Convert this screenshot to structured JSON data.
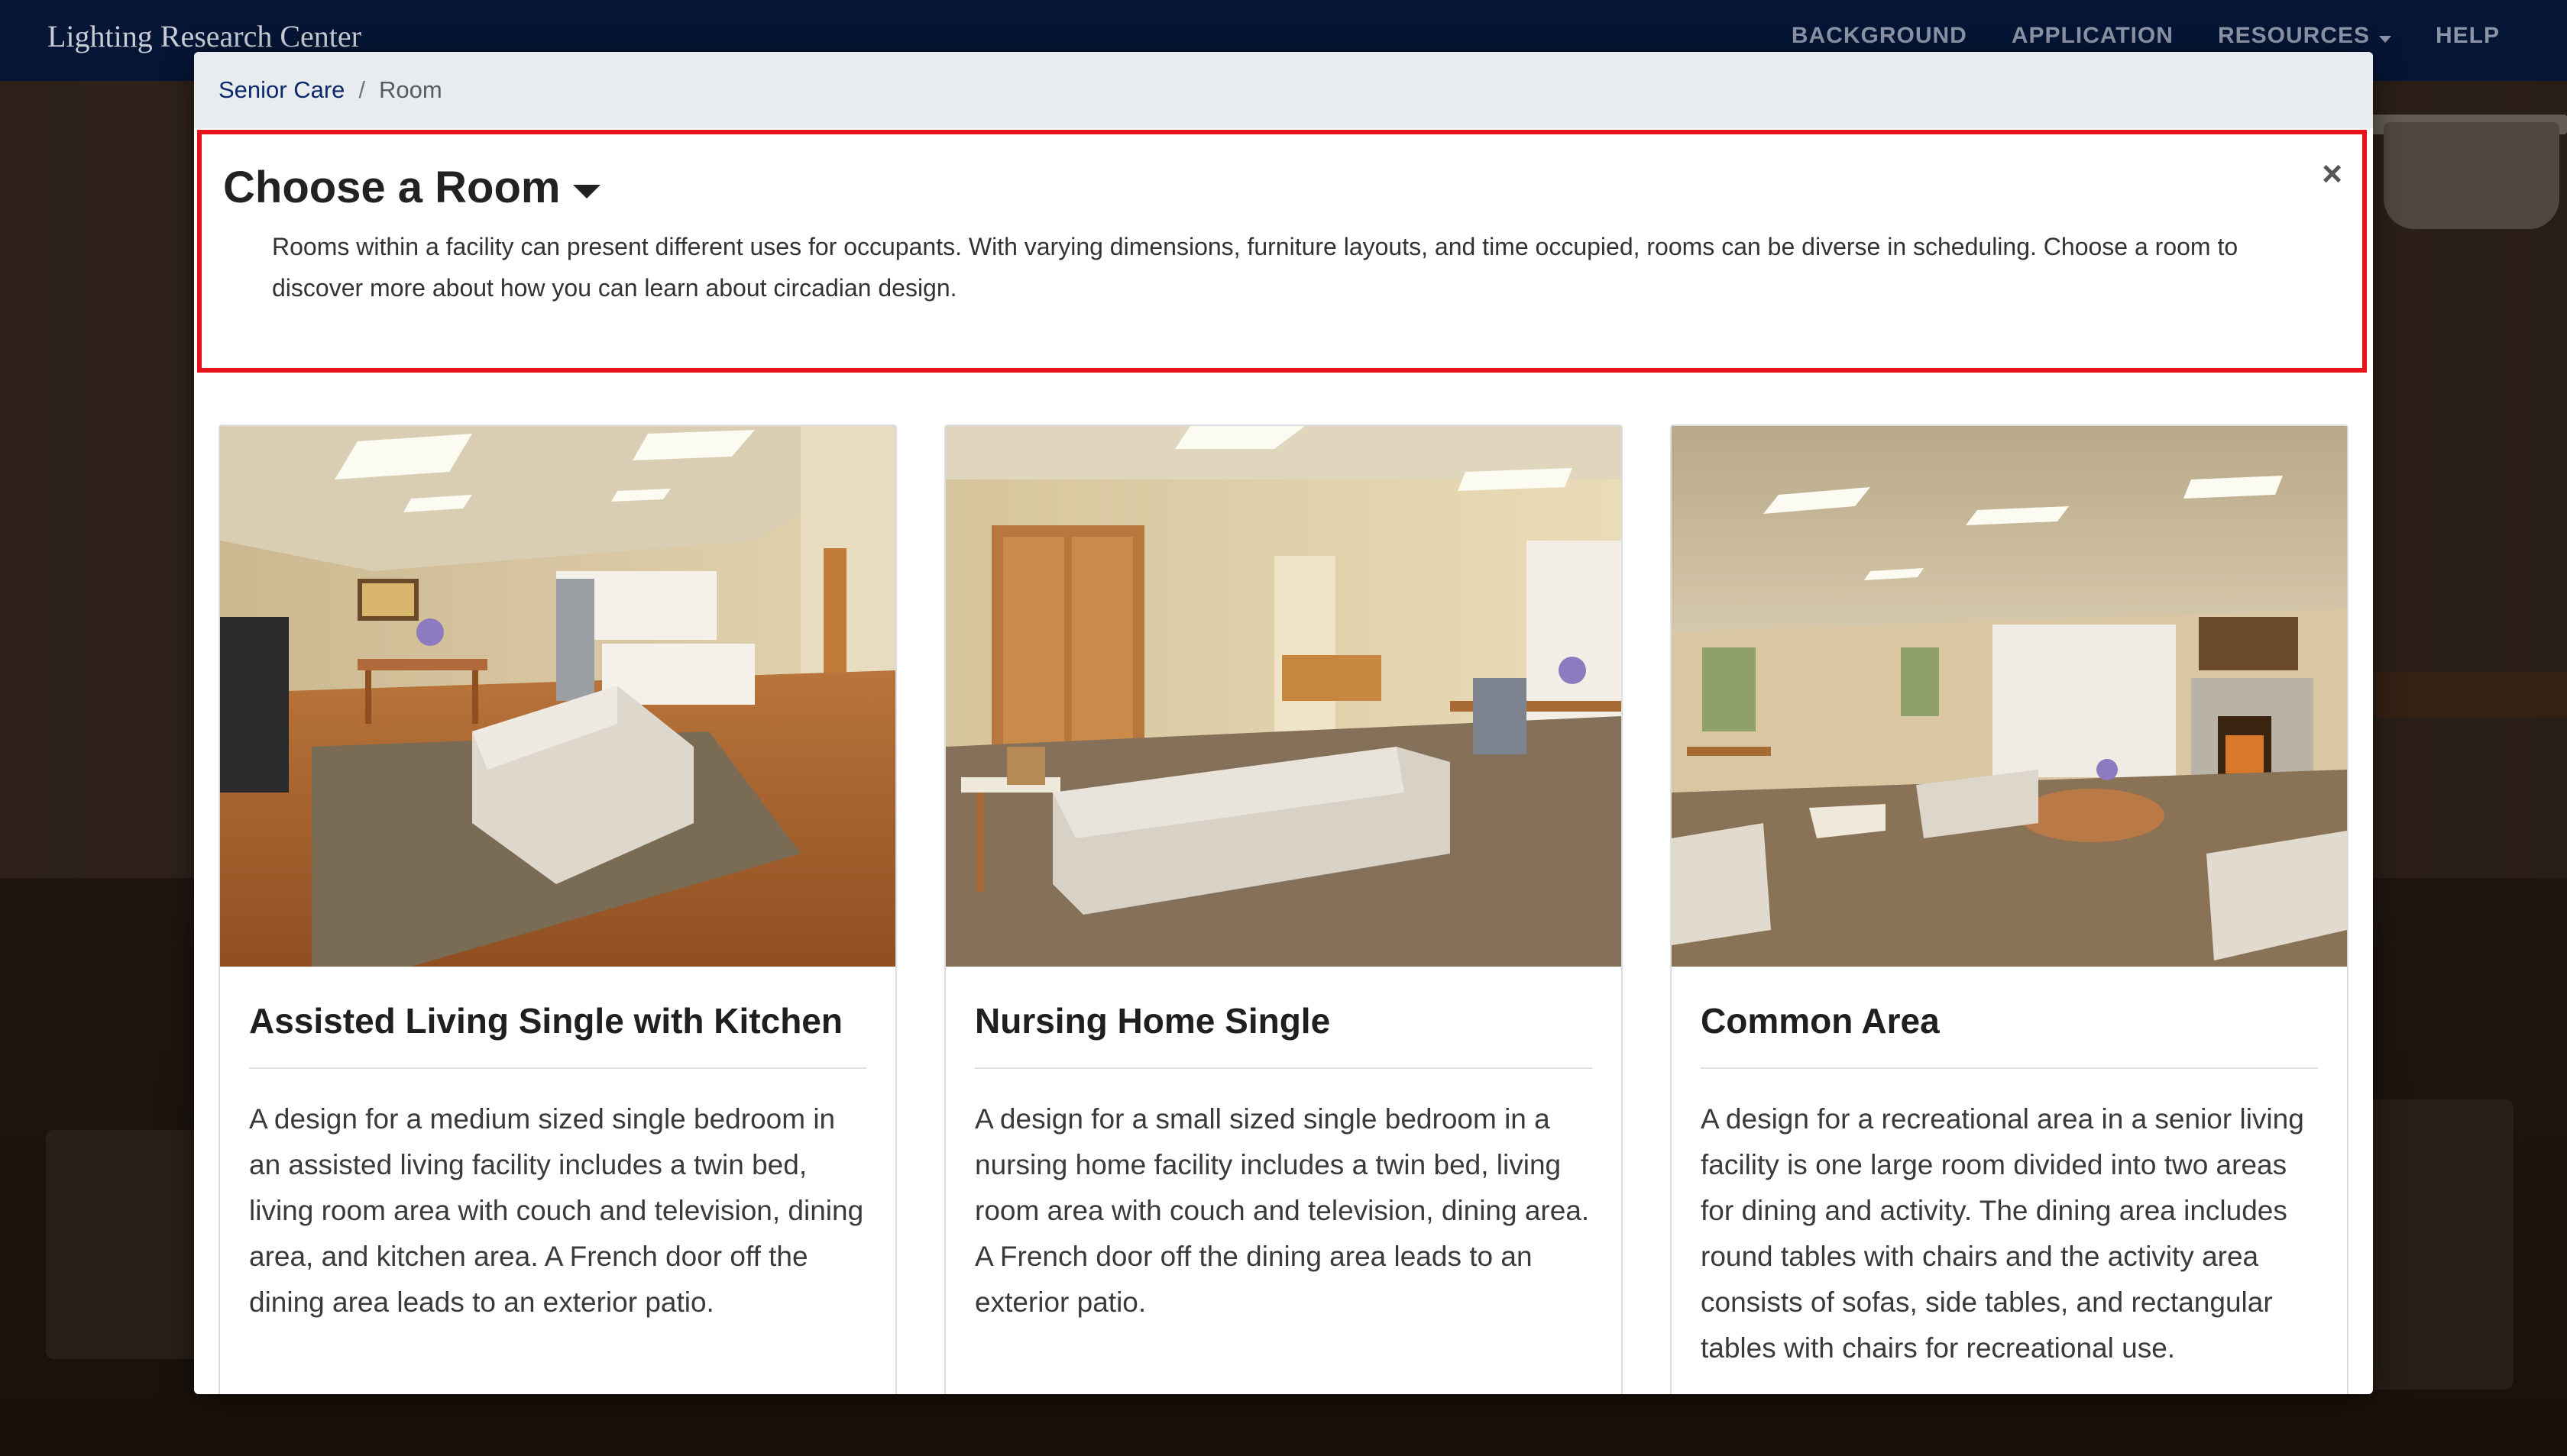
{
  "navbar": {
    "brand": "Lighting Research Center",
    "links": [
      "BACKGROUND",
      "APPLICATION",
      "RESOURCES",
      "HELP"
    ]
  },
  "breadcrumb": {
    "parent": "Senior Care",
    "separator": "/",
    "current": "Room"
  },
  "modal": {
    "title": "Choose a Room",
    "close": "×",
    "description": "Rooms within a facility can present different uses for occupants. With varying dimensions, furniture layouts, and time occupied, rooms can be diverse in scheduling. Choose a room to discover more about how you can learn about circadian design."
  },
  "rooms": [
    {
      "title": "Assisted Living Single with Kitchen",
      "description": "A design for a medium sized single bedroom in an assisted living facility includes a twin bed, living room area with couch and television, dining area, and kitchen area. A French door off the dining area leads to an exterior patio."
    },
    {
      "title": "Nursing Home Single",
      "description": "A design for a small sized single bedroom in a nursing home facility includes a twin bed, living room area with couch and television, dining area. A French door off the dining area leads to an exterior patio."
    },
    {
      "title": "Common Area",
      "description": "A design for a recreational area in a senior living facility is one large room divided into two areas for dining and activity. The dining area includes round tables with chairs and the activity area consists of sofas, side tables, and rectangular tables with chairs for recreational use."
    }
  ],
  "colors": {
    "navbar_bg": "#041535",
    "highlight_border": "#e8141b",
    "link": "#0b2a6b"
  }
}
